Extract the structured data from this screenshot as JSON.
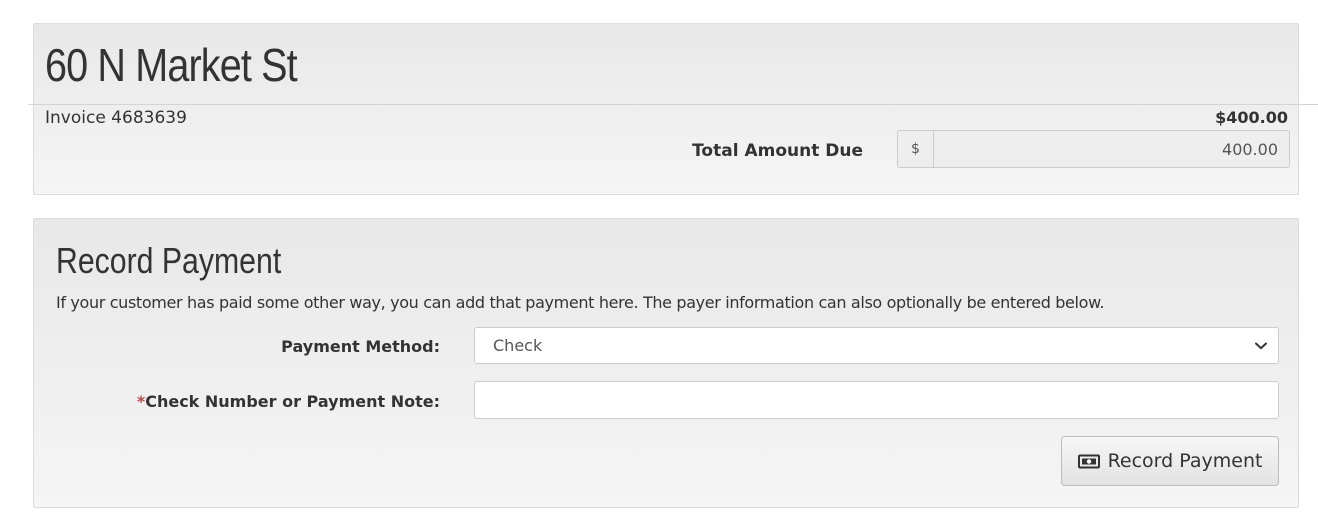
{
  "invoice": {
    "address": "60 N Market St",
    "invoice_label": "Invoice 4683639",
    "total": "$400.00",
    "amount_due_label": "Total Amount Due",
    "currency_symbol": "$",
    "amount_due_value": "400.00"
  },
  "record_payment": {
    "title": "Record Payment",
    "description": "If your customer has paid some other way, you can add that payment here. The payer information can also optionally be entered below.",
    "payment_method_label": "Payment Method:",
    "payment_method_value": "Check",
    "required_marker": "*",
    "note_label": "Check Number or Payment Note:",
    "note_value": "",
    "button_label": "Record Payment",
    "button_icon": "money-icon",
    "select_icon": "chevron-down-icon"
  },
  "colors": {
    "panel_background": "#eeeeee",
    "required": "#b94a48",
    "text": "#333333",
    "muted_text": "#555555"
  }
}
